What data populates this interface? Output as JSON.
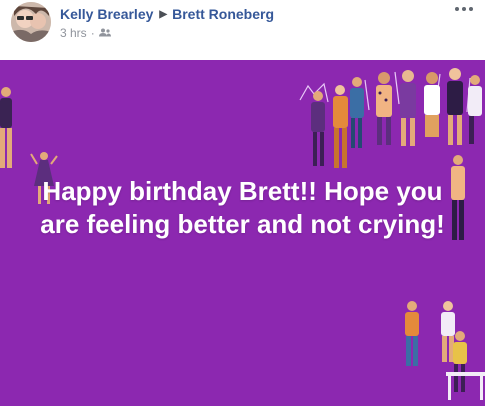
{
  "post": {
    "author": "Kelly Brearley",
    "recipient": "Brett Roneberg",
    "time": "3 hrs",
    "separator": "·",
    "audience_icon": "friends-icon",
    "more_icon": "more-options-icon"
  },
  "banner": {
    "message": "Happy birthday Brett!! Hope you are feeling better and not crying!",
    "background": "#8c28b0"
  }
}
